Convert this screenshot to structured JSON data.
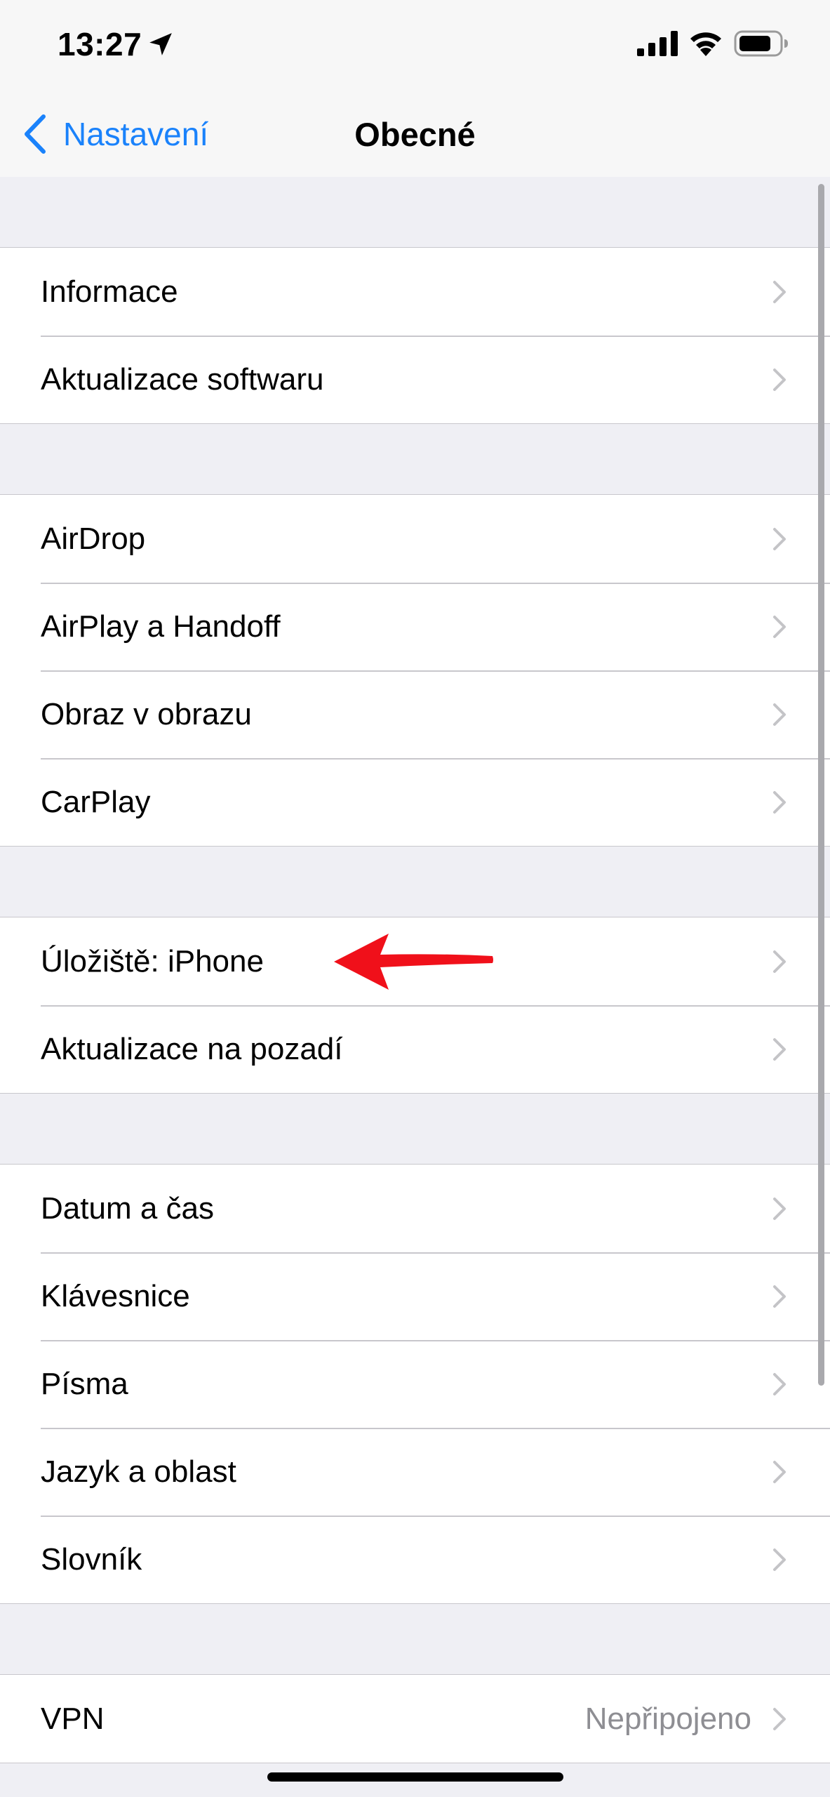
{
  "status_bar": {
    "time": "13:27"
  },
  "nav": {
    "back_label": "Nastavení",
    "title": "Obecné"
  },
  "groups": [
    {
      "items": [
        {
          "label": "Informace"
        },
        {
          "label": "Aktualizace softwaru"
        }
      ]
    },
    {
      "items": [
        {
          "label": "AirDrop"
        },
        {
          "label": "AirPlay a Handoff"
        },
        {
          "label": "Obraz v obrazu"
        },
        {
          "label": "CarPlay"
        }
      ]
    },
    {
      "items": [
        {
          "label": "Úložiště: iPhone"
        },
        {
          "label": "Aktualizace na pozadí"
        }
      ]
    },
    {
      "items": [
        {
          "label": "Datum a čas"
        },
        {
          "label": "Klávesnice"
        },
        {
          "label": "Písma"
        },
        {
          "label": "Jazyk a oblast"
        },
        {
          "label": "Slovník"
        }
      ]
    },
    {
      "items": [
        {
          "label": "VPN",
          "value": "Nepřipojeno"
        }
      ]
    }
  ],
  "colors": {
    "accent": "#1a82fb",
    "background": "#efeff4",
    "separator": "#c8c7cc",
    "secondary_text": "#8e8e93",
    "annotation_arrow": "#f0101a"
  },
  "icons": {
    "location": "location-arrow-icon",
    "signal": "cellular-signal-icon",
    "wifi": "wifi-icon",
    "battery": "battery-icon",
    "back": "chevron-left-icon",
    "row": "chevron-right-icon"
  }
}
